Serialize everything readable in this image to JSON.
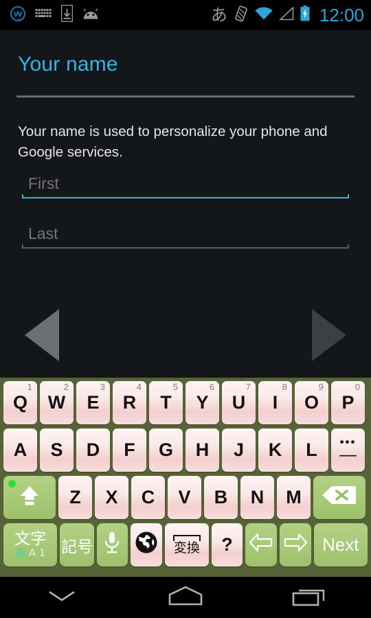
{
  "status_bar": {
    "left_icons": [
      "w-logo-icon",
      "keyboard-icon",
      "download-to-phone-icon",
      "android-head-icon"
    ],
    "ime_indicator": "あ",
    "right_icons": [
      "vibrate-icon",
      "wifi-icon",
      "signal-icon",
      "battery-charging-icon"
    ],
    "clock": "12:00",
    "clock_color": "#33b5e5"
  },
  "screen": {
    "title": "Your name",
    "title_color": "#33b5e5",
    "description": "Your name is used to personalize your phone and Google services.",
    "fields": [
      {
        "name": "first",
        "value": "",
        "placeholder": "First",
        "focused": true
      },
      {
        "name": "last",
        "value": "",
        "placeholder": "Last",
        "focused": false
      }
    ],
    "back_button": "back-arrow",
    "next_button": "next-arrow"
  },
  "keyboard": {
    "theme_bg": "#566336",
    "key_bg": "#fbe9e8",
    "accent_key_bg": "#a8ca78",
    "row1": [
      {
        "label": "Q",
        "num": "1"
      },
      {
        "label": "W",
        "num": "2"
      },
      {
        "label": "E",
        "num": "3"
      },
      {
        "label": "R",
        "num": "4"
      },
      {
        "label": "T",
        "num": "5"
      },
      {
        "label": "Y",
        "num": "6"
      },
      {
        "label": "U",
        "num": "7"
      },
      {
        "label": "I",
        "num": "8"
      },
      {
        "label": "O",
        "num": "9"
      },
      {
        "label": "P",
        "num": "0"
      }
    ],
    "row2": [
      {
        "label": "A"
      },
      {
        "label": "S"
      },
      {
        "label": "D"
      },
      {
        "label": "F"
      },
      {
        "label": "G"
      },
      {
        "label": "H"
      },
      {
        "label": "J"
      },
      {
        "label": "K"
      },
      {
        "label": "L"
      }
    ],
    "row2_symbol_key": {
      "dots": "•••",
      "dash": "—"
    },
    "row3": [
      {
        "label": "Z"
      },
      {
        "label": "X"
      },
      {
        "label": "C"
      },
      {
        "label": "V"
      },
      {
        "label": "B"
      },
      {
        "label": "N"
      },
      {
        "label": "M"
      }
    ],
    "shift_key": {
      "icon": "shift-lock-icon",
      "led_on": true,
      "led_color": "#2ee02e"
    },
    "backspace_key": {
      "icon": "backspace-icon"
    },
    "row4": {
      "mode_key": {
        "main": "文字",
        "sub_kana": "あ",
        "sub_alpha": "A",
        "sub_num": "1"
      },
      "symbol_key": "記号",
      "mic_key": "microphone-icon",
      "globe_key": "globe-icon",
      "space_key": "変換",
      "question_key": "?",
      "left_key": "arrow-left-icon",
      "right_key": "arrow-right-icon",
      "action_key": "Next"
    }
  },
  "navbar": {
    "buttons": [
      "hide-keyboard-icon",
      "home-icon",
      "recents-icon"
    ]
  }
}
